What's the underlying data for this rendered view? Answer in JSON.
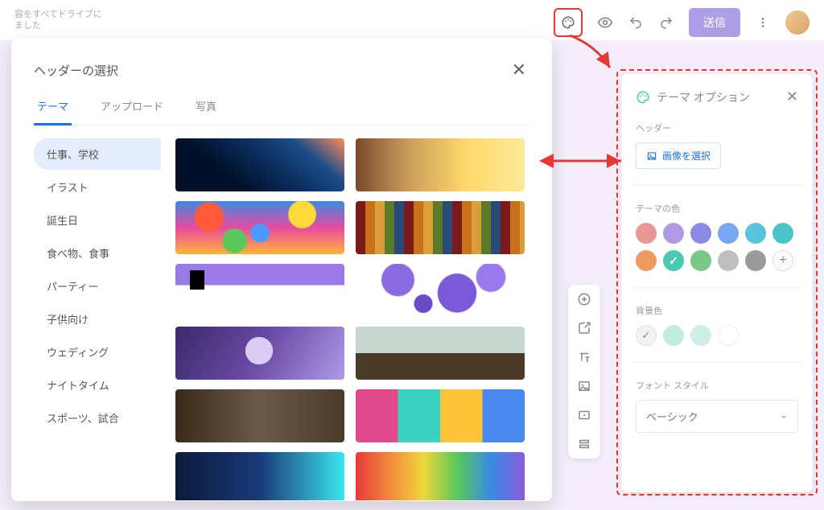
{
  "topbar": {
    "save_text_line1": "容をすべてドライブに",
    "save_text_line2": "ました",
    "send_label": "送信"
  },
  "modal": {
    "title": "ヘッダーの選択",
    "tabs": [
      "テーマ",
      "アップロード",
      "写真"
    ],
    "active_tab": 0,
    "categories": [
      "仕事、学校",
      "イラスト",
      "誕生日",
      "食べ物、食事",
      "パーティー",
      "子供向け",
      "ウェディング",
      "ナイトタイム",
      "スポーツ、試合"
    ],
    "active_category": 0
  },
  "theme_panel": {
    "title": "テーマ オプション",
    "header_label": "ヘッダー",
    "image_select_label": "画像を選択",
    "theme_color_label": "テーマの色",
    "theme_colors": [
      "#e99696",
      "#b09ae6",
      "#8a8ae6",
      "#7aa8f0",
      "#5ac4e0",
      "#4ac4b4",
      "#f09a62",
      "#4acab4",
      "#4acab4",
      "#7ac888",
      "#bfbfbf",
      "#9a9a9a"
    ],
    "selected_theme_color_index": 8,
    "bg_label": "背景色",
    "bg_colors": [
      "#f2f2f0",
      "#c4ebe2",
      "#cfeee7",
      "#f4f4f4"
    ],
    "selected_bg_index": 0,
    "font_label": "フォント スタイル",
    "font_value": "ベーシック"
  }
}
